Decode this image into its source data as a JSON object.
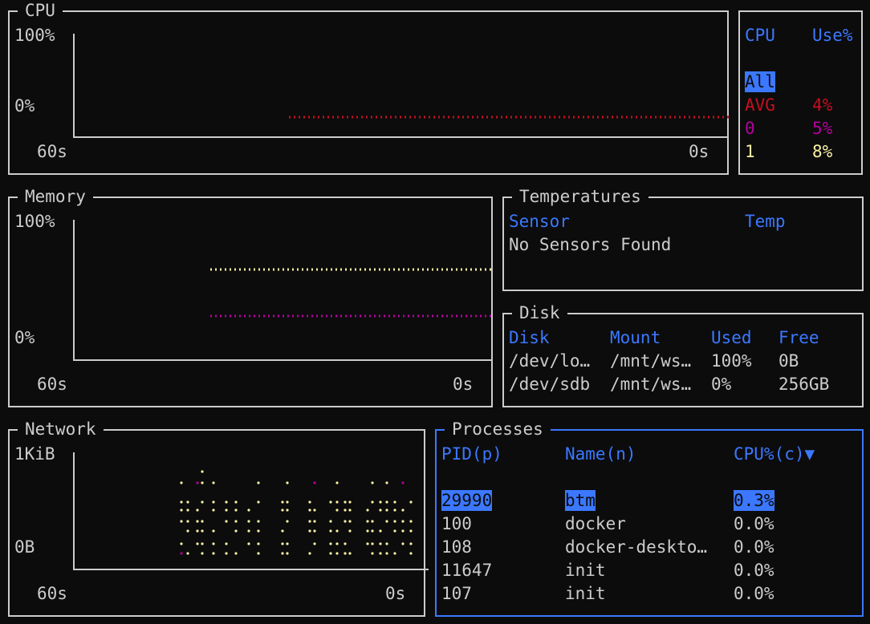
{
  "colors": {
    "background": "#0c0c0c",
    "border": "#cccccc",
    "active_border": "#3b78ff",
    "header": "#3b78ff",
    "avg": "#c50f1f",
    "cpu0": "#b4009e",
    "cpu1": "#f9f1a5",
    "ram": "#f9f1a5",
    "swap": "#b4009e",
    "rx": "#f9f1a5",
    "tx": "#b4009e"
  },
  "cpu": {
    "title": "CPU",
    "y_top": "100%",
    "y_bottom": "0%",
    "x_left": "60s",
    "x_right": "0s",
    "legend": {
      "col_cpu": "CPU",
      "col_use": "Use%",
      "all_label": "All",
      "rows": [
        {
          "name": "AVG",
          "value": "4%"
        },
        {
          "name": "0",
          "value": "5%"
        },
        {
          "name": "1",
          "value": "8%"
        }
      ]
    }
  },
  "memory": {
    "title": "Memory",
    "y_top": "100%",
    "y_bottom": "0%",
    "x_left": "60s",
    "x_right": "0s"
  },
  "temperatures": {
    "title": "Temperatures",
    "col_sensor": "Sensor",
    "col_temp": "Temp",
    "message": "No Sensors Found"
  },
  "disk": {
    "title": "Disk",
    "headers": [
      "Disk",
      "Mount",
      "Used",
      "Free"
    ],
    "rows": [
      [
        "/dev/lo…",
        "/mnt/ws…",
        "100%",
        "0B"
      ],
      [
        "/dev/sdb",
        "/mnt/ws…",
        "0%",
        "256GB"
      ]
    ]
  },
  "network": {
    "title": "Network",
    "y_top": "1KiB",
    "y_bottom": "0B",
    "x_left": "60s",
    "x_right": "0s"
  },
  "processes": {
    "title": "Processes",
    "col_pid": "PID(p)",
    "col_name": "Name(n)",
    "col_cpu": "CPU%(c)▼",
    "rows": [
      [
        "29990",
        "btm",
        "0.3%"
      ],
      [
        "100",
        "docker",
        "0.0%"
      ],
      [
        "108",
        "docker-deskto…",
        "0.0%"
      ],
      [
        "11647",
        "init",
        "0.0%"
      ],
      [
        "107",
        "init",
        "0.0%"
      ]
    ]
  }
}
